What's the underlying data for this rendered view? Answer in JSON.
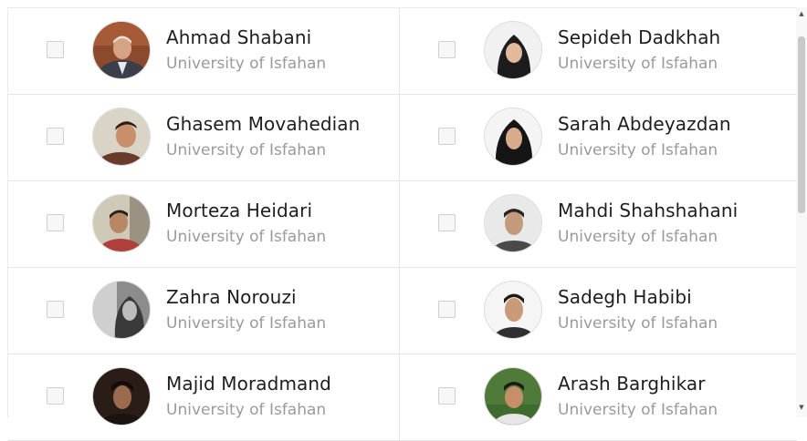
{
  "people": [
    [
      {
        "name": "Ahmad Shabani",
        "affiliation": "University of Isfahan",
        "avatar": "male-older-suit",
        "checked": false
      },
      {
        "name": "Sepideh Dadkhah",
        "affiliation": "University of Isfahan",
        "avatar": "female-hijab",
        "checked": false
      }
    ],
    [
      {
        "name": "Ghasem Movahedian",
        "affiliation": "University of Isfahan",
        "avatar": "male-casual",
        "checked": false
      },
      {
        "name": "Sarah Abdeyazdan",
        "affiliation": "University of Isfahan",
        "avatar": "female-hijab-dark",
        "checked": false
      }
    ],
    [
      {
        "name": "Morteza Heidari",
        "affiliation": "University of Isfahan",
        "avatar": "male-outdoor",
        "checked": false
      },
      {
        "name": "Mahdi Shahshahani",
        "affiliation": "University of Isfahan",
        "avatar": "male-young",
        "checked": false
      }
    ],
    [
      {
        "name": "Zahra Norouzi",
        "affiliation": "University of Isfahan",
        "avatar": "female-bw",
        "checked": false
      },
      {
        "name": "Sadegh Habibi",
        "affiliation": "University of Isfahan",
        "avatar": "male-young-2",
        "checked": false
      }
    ],
    [
      {
        "name": "Majid Moradmand",
        "affiliation": "University of Isfahan",
        "avatar": "male-dark",
        "checked": false
      },
      {
        "name": "Arash Barghikar",
        "affiliation": "University of Isfahan",
        "avatar": "male-outdoor-green",
        "checked": false
      }
    ]
  ],
  "colors": {
    "name_text": "#1e1e1e",
    "affiliation_text": "#9a9a9a",
    "divider": "#e6e6e6",
    "scroll_thumb": "#c9c9c9"
  },
  "scrollbar": {
    "up_glyph": "▲",
    "down_glyph": "▼"
  }
}
